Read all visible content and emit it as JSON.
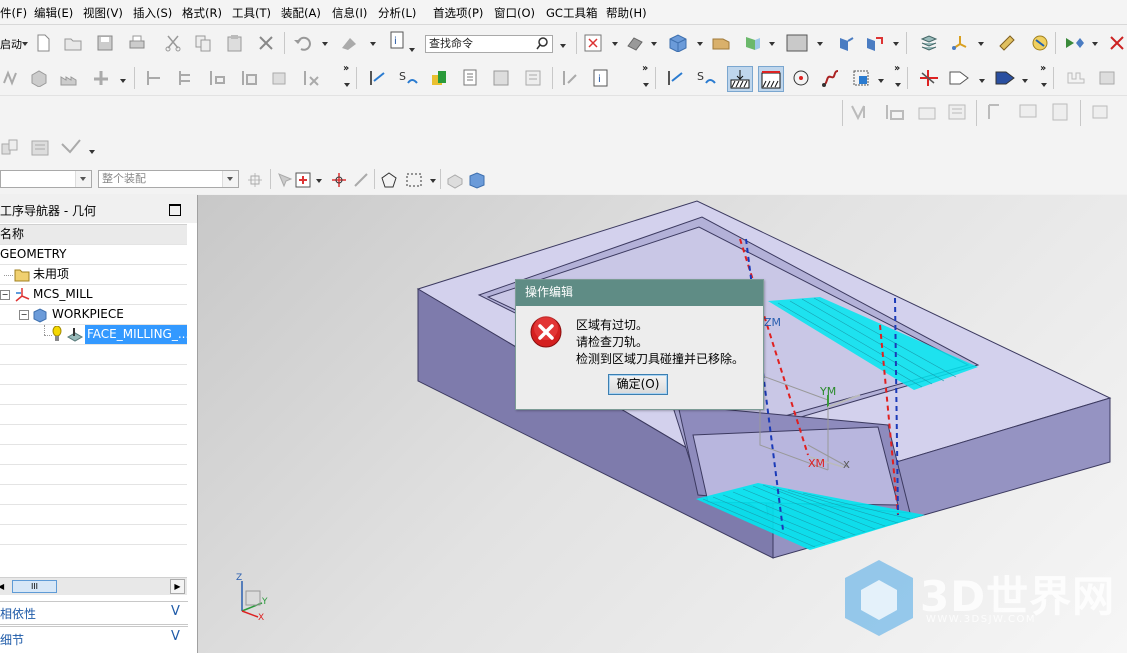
{
  "menu": [
    "件(F)",
    "编辑(E)",
    "视图(V)",
    "插入(S)",
    "格式(R)",
    "工具(T)",
    "装配(A)",
    "信息(I)",
    "分析(L)",
    "首选项(P)",
    "窗口(O)",
    "GC工具箱",
    "帮助(H)"
  ],
  "toolbar": {
    "start_label": "启动",
    "search_placeholder": "查找命令"
  },
  "filter_bar": {
    "type_filter": "",
    "assembly_filter": "整个装配"
  },
  "navigator": {
    "title": "工序导航器 - 几何",
    "column_name": "名称",
    "items": [
      "GEOMETRY",
      "未用项",
      "MCS_MILL",
      "WORKPIECE",
      "FACE_MILLING_..."
    ],
    "scroll_thumb": "III",
    "section_dependency": "相依性",
    "section_details": "细节",
    "section_chevron": "V"
  },
  "dialog": {
    "title": "操作编辑",
    "lines": [
      "区域有过切。",
      "请检查刀轨。",
      "检测到区域刀具碰撞并已移除。"
    ],
    "ok_label": "确定(O)"
  },
  "viewport": {
    "axis_zm": "ZM",
    "axis_ym": "YM",
    "axis_xm": "XM",
    "triad_z": "Z",
    "triad_y": "Y",
    "triad_x": "X"
  },
  "watermark": {
    "text": "3D世界网",
    "url": "WWW.3DSJW.COM"
  },
  "colors": {
    "dialog_title": "#5f8c85",
    "part_top": "#d2d0ec",
    "part_side": "#7d7aaa",
    "toolpath": "#00e6f0"
  }
}
